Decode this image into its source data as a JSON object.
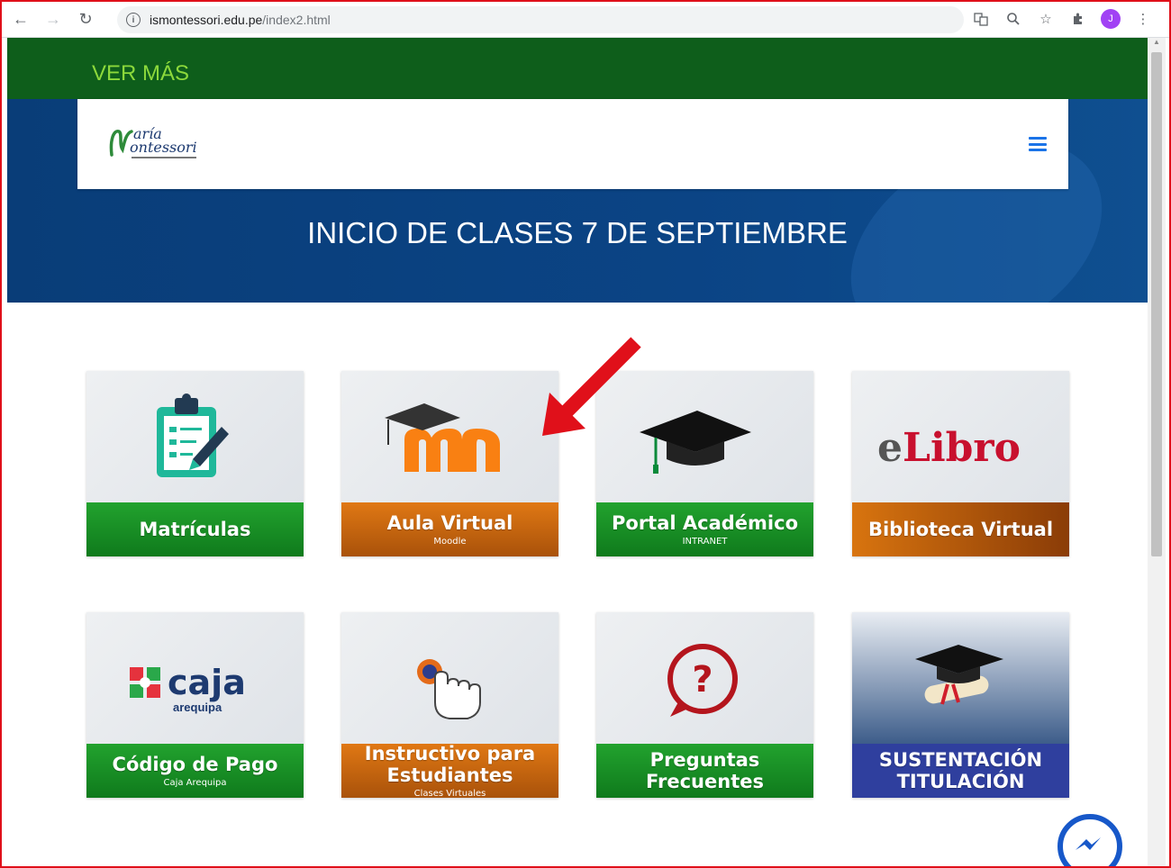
{
  "browser": {
    "url_host": "ismontessori.edu.pe",
    "url_path": "/index2.html",
    "avatar_letter": "J"
  },
  "header": {
    "ver_mas": "VER MÁS",
    "logo_line1": "aría",
    "logo_line2": "ontessori",
    "hero_title": "INICIO DE CLASES 7 DE SEPTIEMBRE"
  },
  "cards": [
    {
      "title": "Matrículas",
      "subtitle": "",
      "color": "green"
    },
    {
      "title": "Aula Virtual",
      "subtitle": "Moodle",
      "color": "orange"
    },
    {
      "title": "Portal Académico",
      "subtitle": "INTRANET",
      "color": "green"
    },
    {
      "title": "Biblioteca Virtual",
      "subtitle": "",
      "color": "orange2"
    },
    {
      "title": "Código de Pago",
      "subtitle": "Caja Arequipa",
      "color": "green"
    },
    {
      "title": "Instructivo para Estudiantes",
      "subtitle": "Clases Virtuales",
      "color": "orange"
    },
    {
      "title": "Preguntas Frecuentes",
      "subtitle": "",
      "color": "green"
    },
    {
      "title": "SUSTENTACIÓN TITULACIÓN",
      "subtitle": "",
      "color": "blue"
    }
  ],
  "logos": {
    "elibro_e": "e",
    "elibro_rest": "Libro",
    "caja_word": "caja",
    "caja_sub": "arequipa"
  },
  "colors": {
    "topbar": "#0e5e1b",
    "hero": "#0b4485",
    "ver_mas": "#8cd93b",
    "annotation_arrow": "#e0101a"
  }
}
